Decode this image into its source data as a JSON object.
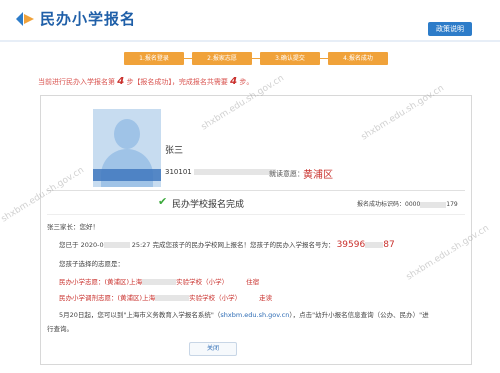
{
  "header": {
    "title": "民办小学报名",
    "policy_button": "政策说明"
  },
  "steps": [
    "1.报名登录",
    "2.报家志愿",
    "3.确认提交",
    "4.报名成功"
  ],
  "progress": {
    "prefix": "当前进行民办入学报名第",
    "current": "4",
    "middle": "步【报名成功】，完成报名共需要",
    "total": "4",
    "suffix": "步。"
  },
  "profile": {
    "name": "张三",
    "id_prefix": "310101",
    "district_label": "就读意愿：",
    "district": "黄浦区"
  },
  "completion": {
    "title": "民办学校报名完成",
    "code_label": "报名成功标识码：",
    "code_prefix": "0000",
    "code_suffix": "179"
  },
  "message": {
    "greeting": "张三家长：您好！",
    "line1_pre": "您已于",
    "line1_date": "2020-0",
    "line1_time": "25:27",
    "line1_mid": "完成您孩子的民办学校网上报名！您孩子的民办入学报名号为：",
    "reg_no_prefix": "39596",
    "reg_no_suffix": "87",
    "choices_title": "您孩子选择的志愿是：",
    "choice1_label": "民办小学志愿：(黄浦区)上海",
    "choice1_school": "实验学校（小学）",
    "choice1_status": "住宿",
    "choice2_label": "民办小学调剂志愿：(黄浦区)上海",
    "choice2_school": "实验学校（小学）",
    "choice2_status": "走读",
    "notice_pre": "5月20日起，您可以到\"上海市义务教育入学报名系统\"（",
    "notice_link": "shxbm.edu.sh.gov.cn",
    "notice_post": "），点击\"幼升小报名信息查询（公办、民办）\"进",
    "notice_end": "行查询。"
  },
  "close_button": "关闭",
  "watermark": "shxbm.edu.sh.gov.cn"
}
